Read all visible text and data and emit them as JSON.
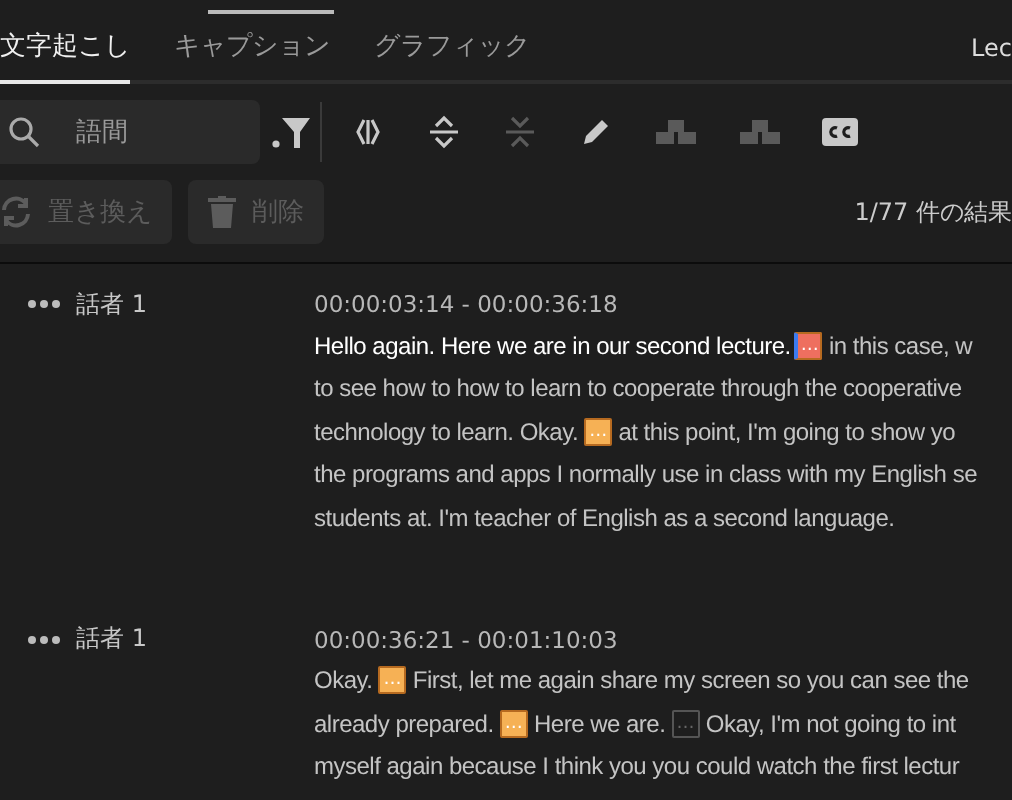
{
  "tabs": [
    {
      "label": "文字起こし",
      "selected": true
    },
    {
      "label": "キャプション",
      "selected": false
    },
    {
      "label": "グラフィック",
      "selected": false
    }
  ],
  "tab_right": "Lec",
  "search": {
    "placeholder": "語間"
  },
  "tools": [
    {
      "kind": "filter",
      "disabled": false
    },
    {
      "kind": "split",
      "disabled": false
    },
    {
      "kind": "expand",
      "disabled": false
    },
    {
      "kind": "collapse",
      "disabled": true
    },
    {
      "kind": "edit",
      "disabled": false
    },
    {
      "kind": "merge-up",
      "disabled": true
    },
    {
      "kind": "merge-side",
      "disabled": true
    },
    {
      "kind": "cc",
      "disabled": false
    }
  ],
  "actions": [
    {
      "kind": "replace",
      "label": "置き換え",
      "disabled": true
    },
    {
      "kind": "delete",
      "label": "削除",
      "disabled": true
    }
  ],
  "result_count": "1/77 件の結果",
  "segments": [
    {
      "speaker": "話者 1",
      "time": "00:00:03:14 - 00:00:36:18",
      "lines": [
        [
          {
            "kind": "text",
            "text": "Hello again. Here we are in our second lecture.",
            "spoken": true
          },
          {
            "kind": "pause",
            "mark": "…",
            "current": true,
            "highlighted": true
          },
          {
            "kind": "text",
            "text": " in this case, w",
            "spoken": false
          }
        ],
        [
          {
            "kind": "text",
            "text": "to see how to how to learn to cooperate through the cooperative",
            "spoken": false
          }
        ],
        [
          {
            "kind": "text",
            "text": "technology to learn. Okay. ",
            "spoken": false
          },
          {
            "kind": "pause",
            "mark": "…",
            "current": false,
            "highlighted": true
          },
          {
            "kind": "text",
            "text": " at this point, I'm going to show yo",
            "spoken": false
          }
        ],
        [
          {
            "kind": "text",
            "text": "the programs and apps I normally use in class with my English se",
            "spoken": false
          }
        ],
        [
          {
            "kind": "text",
            "text": "students at. I'm teacher of English as a second language.",
            "spoken": false
          }
        ]
      ]
    },
    {
      "speaker": "話者 1",
      "time": "00:00:36:21 - 00:01:10:03",
      "lines": [
        [
          {
            "kind": "text",
            "text": "Okay. ",
            "spoken": false
          },
          {
            "kind": "pause",
            "mark": "…",
            "current": false,
            "highlighted": true
          },
          {
            "kind": "text",
            "text": " First, let me again share my screen so you can see the",
            "spoken": false
          }
        ],
        [
          {
            "kind": "text",
            "text": "already prepared. ",
            "spoken": false
          },
          {
            "kind": "pause",
            "mark": "…",
            "current": false,
            "highlighted": true
          },
          {
            "kind": "text",
            "text": " Here we are. ",
            "spoken": false
          },
          {
            "kind": "pause",
            "mark": "…",
            "current": false,
            "highlighted": false
          },
          {
            "kind": "text",
            "text": " Okay, I'm not going to int",
            "spoken": false
          }
        ],
        [
          {
            "kind": "text",
            "text": "myself again because I think you you could watch the first lectur",
            "spoken": false
          }
        ]
      ]
    }
  ]
}
